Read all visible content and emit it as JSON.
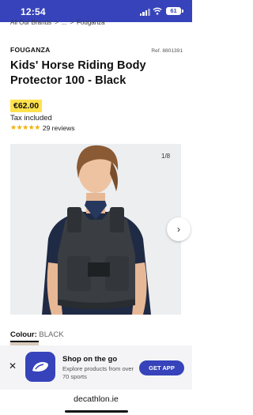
{
  "status_bar": {
    "time": "12:54",
    "battery": "61"
  },
  "breadcrumb": [
    "All Our Brands",
    ">",
    "...",
    ">",
    "Fouganza"
  ],
  "product": {
    "brand": "FOUGANZA",
    "ref": "Ref. 8801391",
    "title": "Kids' Horse Riding Body Protector 100 - Black",
    "price": "€62.00",
    "tax": "Tax included",
    "stars": "★★★★★",
    "rating_fraction": 0.9,
    "reviews": "29 reviews",
    "image_counter": "1/8",
    "colour_label": "Colour:",
    "colour_value": "BLACK"
  },
  "app_banner": {
    "title": "Shop on the go",
    "subtitle": "Explore products from over 70 sports",
    "button": "GET APP"
  },
  "browser": {
    "url": "decathlon.ie"
  },
  "colors": {
    "brand_blue": "#3643ba",
    "price_yellow": "#ffe14d",
    "star": "#f2b100"
  },
  "icons": [
    "signal-icon",
    "wifi-icon",
    "battery-icon",
    "chevron-right-icon",
    "close-icon",
    "decathlon-logo-icon"
  ]
}
